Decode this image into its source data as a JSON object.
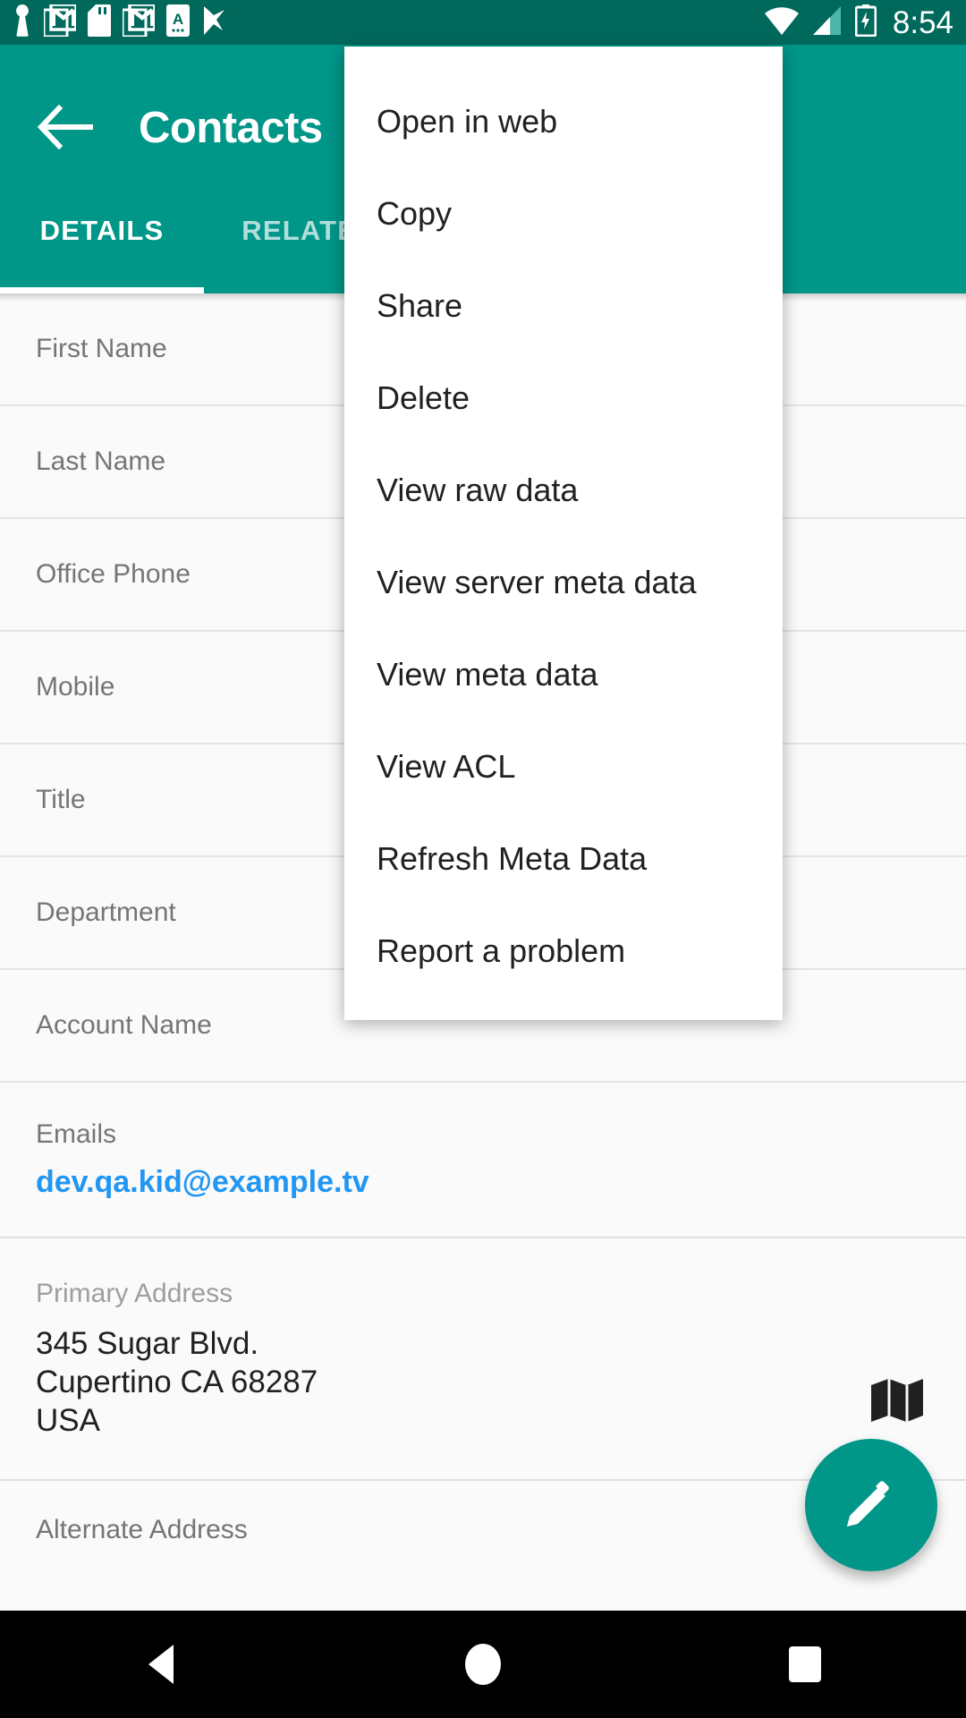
{
  "status_bar": {
    "icons": [
      "keyhole-icon",
      "gmail-icon",
      "sd-card-icon",
      "gmail-icon",
      "a-app-icon",
      "checkmark-icon"
    ],
    "right_icons": [
      "wifi-icon",
      "cellular-signal-icon",
      "battery-charging-icon"
    ],
    "time": "8:54",
    "background": "#00695c"
  },
  "app_bar": {
    "back_icon": "arrow-back-icon",
    "title": "Contacts",
    "background": "#009688",
    "tabs": [
      {
        "label": "DETAILS",
        "selected": true
      },
      {
        "label": "RELATED",
        "selected": false
      }
    ]
  },
  "details": {
    "fields": [
      {
        "label": "First Name",
        "value": ""
      },
      {
        "label": "Last Name",
        "value": ""
      },
      {
        "label": "Office Phone",
        "value": ""
      },
      {
        "label": "Mobile",
        "value": ""
      },
      {
        "label": "Title",
        "value": ""
      },
      {
        "label": "Department",
        "value": ""
      },
      {
        "label": "Account Name",
        "value": ""
      }
    ],
    "emails": {
      "label": "Emails",
      "value": "dev.qa.kid@example.tv",
      "link_color": "#2196f3"
    },
    "primary_address": {
      "label": "Primary Address",
      "value": "345 Sugar Blvd.\nCupertino CA 68287\nUSA",
      "map_icon": "map-icon"
    },
    "alternate_address": {
      "label": "Alternate Address",
      "value": ""
    }
  },
  "fab": {
    "icon": "edit-pencil-icon",
    "color": "#009688"
  },
  "overflow_menu": {
    "items": [
      {
        "label": "Open in web"
      },
      {
        "label": "Copy"
      },
      {
        "label": "Share"
      },
      {
        "label": "Delete"
      },
      {
        "label": "View raw data"
      },
      {
        "label": "View server meta data"
      },
      {
        "label": "View meta data"
      },
      {
        "label": "View ACL"
      },
      {
        "label": "Refresh Meta Data"
      },
      {
        "label": "Report a problem"
      }
    ]
  },
  "nav_bar": {
    "back": "nav-back-icon",
    "home": "nav-home-icon",
    "recents": "nav-recents-icon"
  }
}
